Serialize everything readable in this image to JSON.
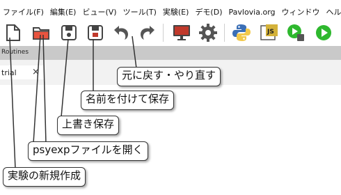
{
  "menu": {
    "items": [
      "ファイル(F)",
      "編集(E)",
      "ビュー(V)",
      "ツール(T)",
      "実験(E)",
      "デモ(D)",
      "Pavlovia.org",
      "ウィンドウ",
      "ヘルプ"
    ]
  },
  "toolbar": {
    "icons": [
      "new-file-icon",
      "open-folder-icon",
      "save-icon",
      "save-as-icon",
      "undo-icon",
      "redo-icon",
      "monitor-icon",
      "gear-icon",
      "python-icon",
      "js-icon",
      "run-python-icon",
      "run-icon"
    ]
  },
  "panel": {
    "header": "Routines",
    "tab_label": "trial",
    "tab_close": "×"
  },
  "callouts": {
    "undo_redo": "元に戻す・やり直す",
    "save_as": "名前を付けて保存",
    "save": "上書き保存",
    "open": "psyexpファイルを開く",
    "new": "実験の新規作成"
  },
  "colors": {
    "folder": "#e8543f",
    "disk": "#4a4a4a",
    "monitor_red": "#c0392b",
    "run_green": "#2eb82e",
    "js_yellow": "#d4b23a",
    "python_blue": "#3b6fb6",
    "python_yellow": "#f2c94c"
  }
}
